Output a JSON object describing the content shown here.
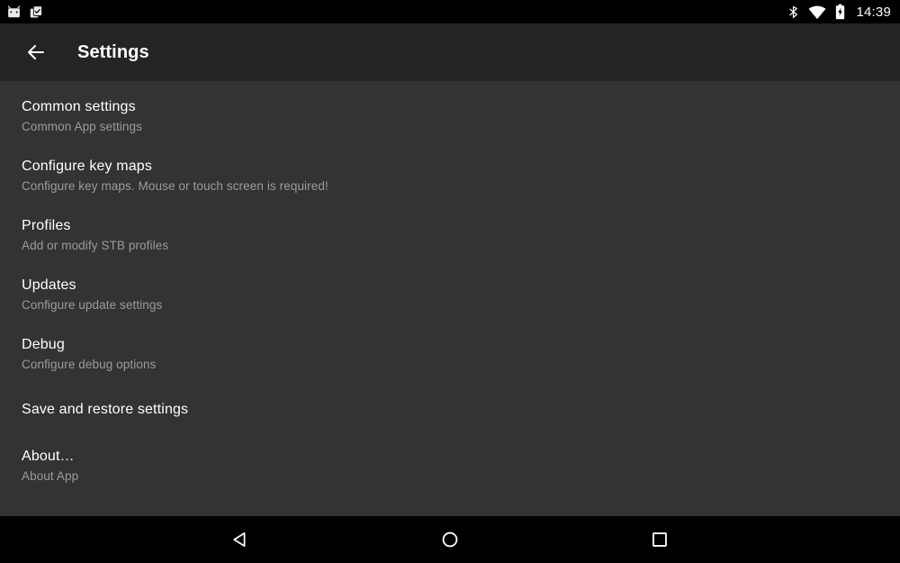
{
  "status_bar": {
    "left_icons": [
      {
        "name": "android-head-icon",
        "label": "Android robot notification"
      },
      {
        "name": "clipboard-check-icon",
        "label": "Clipboard with checkmark notification"
      }
    ],
    "right_icons": [
      {
        "name": "bluetooth-icon",
        "label": "Bluetooth"
      },
      {
        "name": "wifi-icon",
        "label": "Wi-Fi signal full"
      },
      {
        "name": "battery-charging-icon",
        "label": "Battery charging"
      }
    ],
    "time": "14:39"
  },
  "toolbar": {
    "back_icon": "arrow-back-icon",
    "title": "Settings"
  },
  "settings_list": [
    {
      "title": "Common settings",
      "subtitle": "Common App settings"
    },
    {
      "title": "Configure key maps",
      "subtitle": "Configure key maps. Mouse or touch screen is required!"
    },
    {
      "title": "Profiles",
      "subtitle": "Add or modify STB profiles"
    },
    {
      "title": "Updates",
      "subtitle": "Configure update settings"
    },
    {
      "title": "Debug",
      "subtitle": "Configure debug options"
    },
    {
      "title": "Save and restore settings",
      "subtitle": ""
    },
    {
      "title": "About…",
      "subtitle": "About App"
    }
  ],
  "nav_bar": {
    "back_label": "Back",
    "home_label": "Home",
    "recents_label": "Recent apps"
  },
  "colors": {
    "status_bar_bg": "#000000",
    "toolbar_bg": "#242424",
    "content_bg": "#333333",
    "nav_bar_bg": "#000000",
    "title_text": "#ffffff",
    "subtitle_text": "#9b9b9b"
  }
}
